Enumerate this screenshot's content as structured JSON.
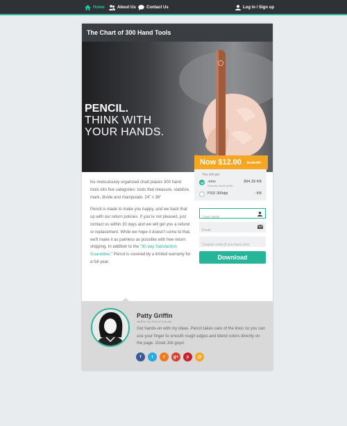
{
  "nav": {
    "home_label": "Home",
    "about_label": "About Us",
    "contact_label": "Contact Us",
    "login_label": "Log in / Sign up",
    "accent": "#27b59a"
  },
  "card": {
    "title": "The Chart of 300 Hand Tools"
  },
  "hero": {
    "line1": "PENCIL.",
    "line2": "THINK WITH",
    "line3": "YOUR HANDS."
  },
  "description": {
    "p1": "his meticulously organized chart places 300 hand tools into five categories: tools that measure, stabilize, mark, divide and manipulate. 24\" x 36\"",
    "p2_part1": "Pencil is made to make you happy, and we back that up with our return policies. If you're not pleased, just contact us within 30 days and we will get you a refund or replacement. While we hope it doesn't come to that, we'll make it as painless as possible with free return shipping. In addition to the ",
    "p2_link": "\"30-day Satisfaction Guarantee,\"",
    "p2_part2": " Pencil is covered by a limited warranty for a full year."
  },
  "purchase": {
    "price_now": "Now $12.00",
    "price_old": "$ 25.99",
    "price_color": "#f5a623",
    "you_will_get": "You will get",
    "options": [
      {
        "name": ".mov",
        "sub": "Includes working file*",
        "size": "894.39 KB",
        "selected": true
      },
      {
        "name": "PSD 300dpi",
        "sub": "",
        "size": "- KB",
        "selected": false
      }
    ],
    "user_placeholder": "User name",
    "email_placeholder": "Email",
    "coupon_placeholder": "Coupon code (if you have one)",
    "download_label": "Download"
  },
  "testimonial": {
    "name": "Patty Griffin",
    "date": "MARCH 16, 2013 AT 3:48 AM",
    "quote": "Get hands-on with my ideas. Pencil takes care of the lines so you can use your finger to smooth rough edges and blend colors directly on the page. Good Job guys!",
    "socials": [
      {
        "icon": "facebook-icon",
        "glyph": "f",
        "color": "#3b5998"
      },
      {
        "icon": "twitter-icon",
        "glyph": "t",
        "color": "#2aa9e0"
      },
      {
        "icon": "rss-icon",
        "glyph": "r",
        "color": "#f07a21"
      },
      {
        "icon": "google-plus-icon",
        "glyph": "g+",
        "color": "#d9402f"
      },
      {
        "icon": "pinterest-icon",
        "glyph": "p",
        "color": "#c8232c"
      },
      {
        "icon": "email-icon",
        "glyph": "@",
        "color": "#f5a623"
      }
    ]
  }
}
